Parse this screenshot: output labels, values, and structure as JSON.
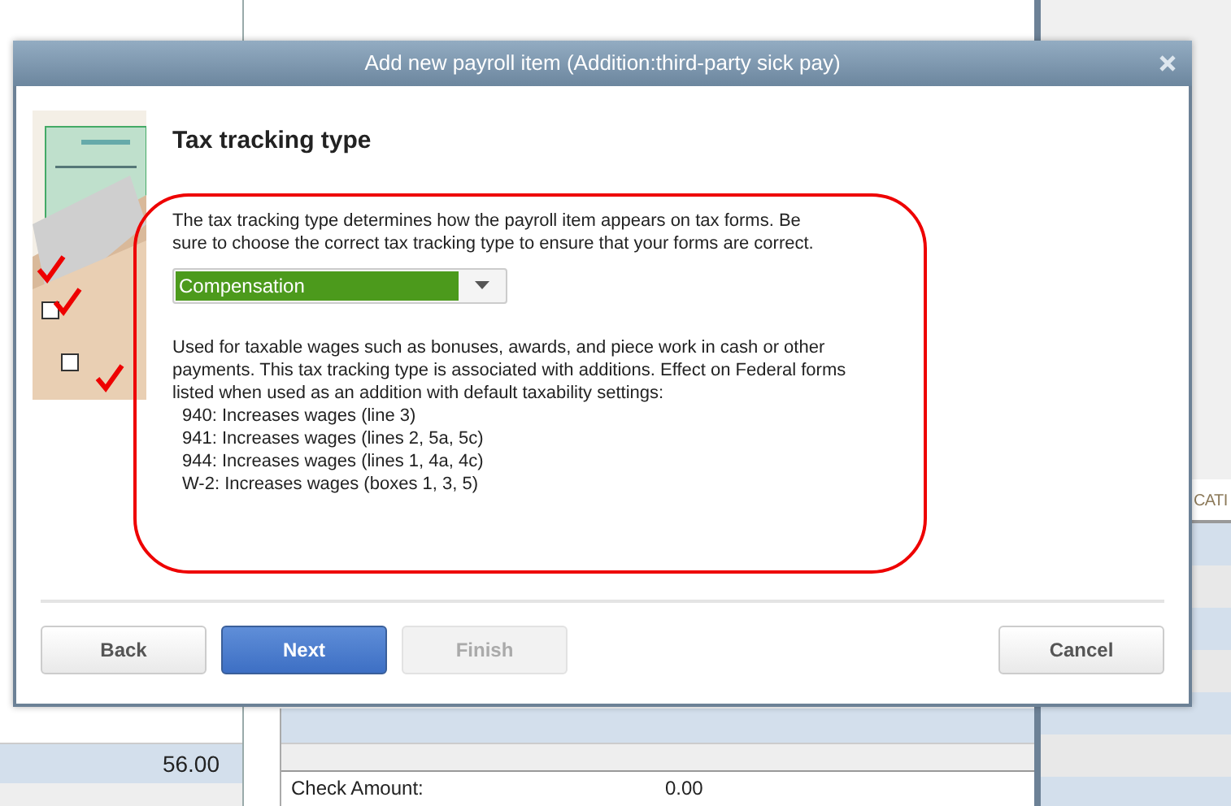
{
  "background": {
    "amount_cells": [
      "56.00"
    ],
    "column_header": "CATI",
    "check_amount": {
      "label": "Check Amount:",
      "value": "0.00"
    }
  },
  "dialog": {
    "title": "Add new payroll item (Addition:third-party sick pay)",
    "heading": "Tax tracking type",
    "intro": "The tax tracking type determines how the payroll item appears on tax forms.  Be sure to choose the correct tax tracking type to ensure that your forms are correct.",
    "dropdown": {
      "value": "Compensation"
    },
    "description": "Used for taxable wages such as bonuses, awards, and piece work in cash or other payments. This tax tracking type is associated with additions. Effect on Federal forms listed when used as an addition with default taxability settings:",
    "effects": [
      "940: Increases wages (line 3)",
      "941: Increases wages (lines 2, 5a, 5c)",
      "944: Increases wages (lines 1, 4a, 4c)",
      "W-2: Increases wages (boxes 1, 3, 5)"
    ],
    "buttons": [
      {
        "label": "Back",
        "kind": "plain",
        "disabled": false
      },
      {
        "label": "Next",
        "kind": "primary",
        "disabled": false
      },
      {
        "label": "Finish",
        "kind": "plain",
        "disabled": true
      },
      {
        "label": "Cancel",
        "kind": "plain",
        "disabled": false
      }
    ]
  }
}
